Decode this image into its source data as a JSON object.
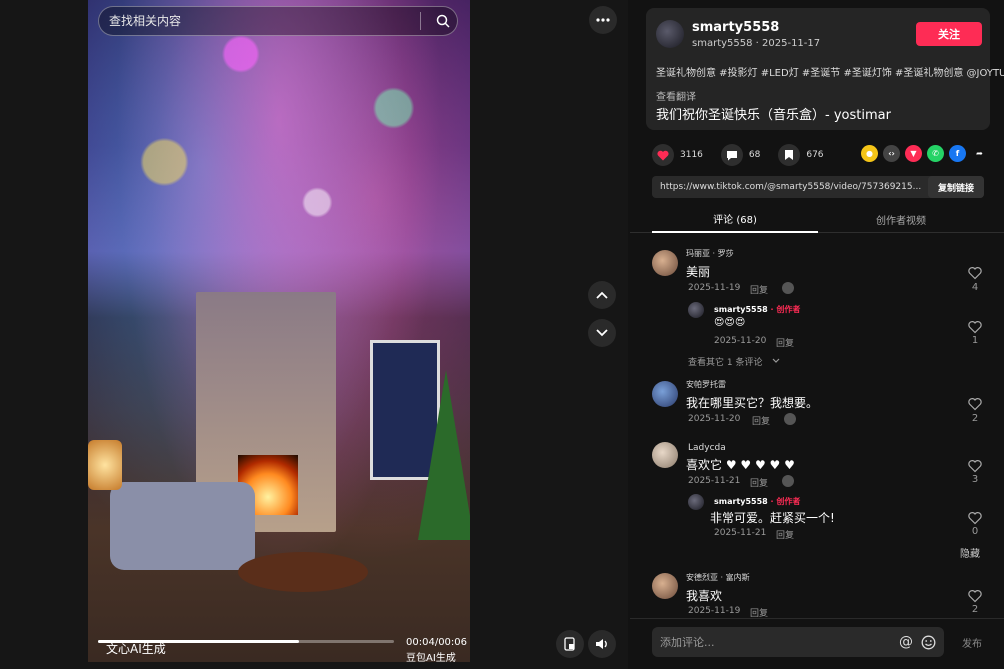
{
  "search": {
    "placeholder": "查找相关内容"
  },
  "video": {
    "ai_label": "文心AI生成",
    "time": "00:04/00:06",
    "watermark": "豆包AI生成",
    "progress": 0.68
  },
  "author": {
    "username": "smarty5558",
    "sub": "smarty5558 · 2025-11-17",
    "follow_label": "关注",
    "tags": "圣诞礼物创意 #投影灯 #LED灯 #圣诞节 #圣诞灯饰 #圣诞礼物创意 @JOYTUTUS",
    "translate": "查看翻译",
    "description": "我们祝你圣诞快乐（音乐盒）- yostimar"
  },
  "stats": {
    "likes": "3116",
    "comments": "68",
    "saves": "676"
  },
  "share_icons": [
    "coin-icon",
    "embed-icon",
    "send-icon",
    "whatsapp-icon",
    "facebook-icon",
    "forward-icon"
  ],
  "colors": {
    "accent": "#fe2c55",
    "whatsapp": "#25d366",
    "facebook": "#1877f2",
    "coin": "#f5c518",
    "embed": "#444444",
    "send": "#fe2c55"
  },
  "link": {
    "url": "https://www.tiktok.com/@smarty5558/video/757369215...",
    "copy_label": "复制链接"
  },
  "tabs": {
    "comments": "评论 (68)",
    "creator_videos": "创作者视频"
  },
  "comments": [
    {
      "name": "玛丽亚 · 罗莎",
      "text": "美丽",
      "date": "2025-11-19",
      "reply": "回复",
      "likes": "4"
    },
    {
      "name": "smarty5558",
      "creator_tag": " · 创作者",
      "text": "😍😍😍",
      "date": "2025-11-20",
      "reply": "回复",
      "likes": "1"
    },
    {
      "more": "查看其它 1 条评论"
    },
    {
      "name": "安帕罗托雷",
      "text": "我在哪里买它？我想要。",
      "date": "2025-11-20",
      "reply": "回复",
      "likes": "2"
    },
    {
      "name": "Ladycda",
      "text": "喜欢它 ♥ ♥ ♥ ♥ ♥",
      "date": "2025-11-21",
      "reply": "回复",
      "likes": "3"
    },
    {
      "name": "smarty5558",
      "creator_tag": " · 创作者",
      "text": "非常可爱。赶紧买一个!",
      "date": "2025-11-21",
      "reply": "回复",
      "likes": "0"
    },
    {
      "hide": "隐藏"
    },
    {
      "name": "安德烈亚 · 富内斯",
      "text": "我喜欢",
      "date": "2025-11-19",
      "reply": "回复",
      "likes": "2"
    }
  ],
  "comment_input": {
    "placeholder": "添加评论...",
    "publish": "发布"
  }
}
